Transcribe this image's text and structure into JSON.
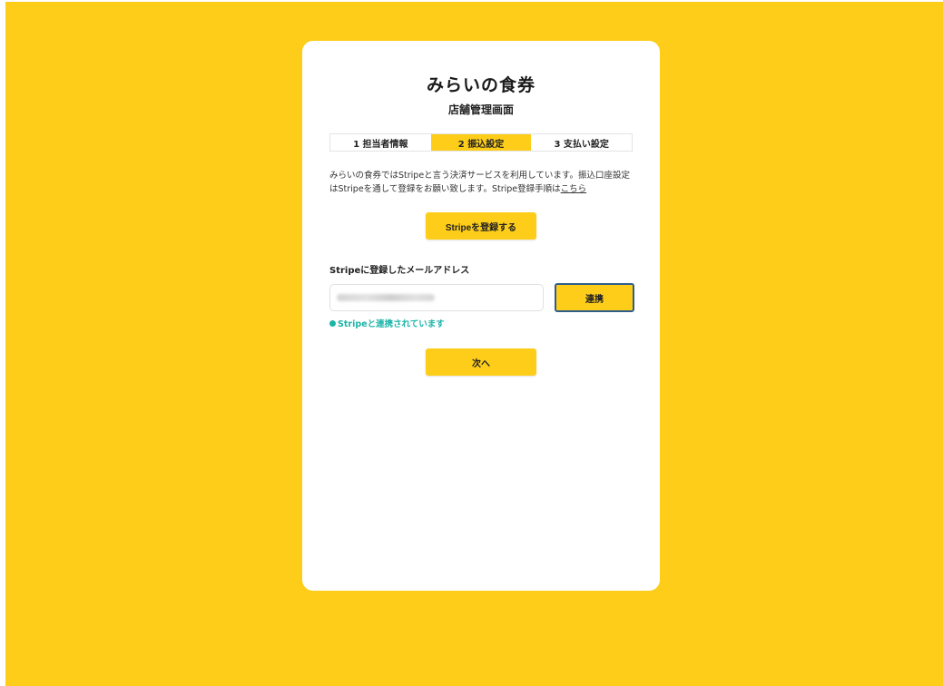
{
  "brand": {
    "logo_text": "みらいの食券",
    "subtitle": "店舗管理画面"
  },
  "steps": [
    {
      "label": "1 担当者情報",
      "active": false
    },
    {
      "label": "2 振込設定",
      "active": true
    },
    {
      "label": "3 支払い設定",
      "active": false
    }
  ],
  "description": {
    "text": "みらいの食券ではStripeと言う決済サービスを利用しています。振込口座設定はStripeを通して登録をお願い致します。Stripe登録手順は",
    "link_label": "こちら"
  },
  "register_button_label": "Stripeを登録する",
  "email_field": {
    "label": "Stripeに登録したメールアドレス",
    "value": "",
    "placeholder": ""
  },
  "link_button_label": "連携",
  "status_text": "Stripeと連携されています",
  "next_button_label": "次へ",
  "colors": {
    "background": "#fdcd1a",
    "accent": "#fdcd1a",
    "status": "#1bb5a8",
    "focus_border": "#2f5d8a"
  }
}
